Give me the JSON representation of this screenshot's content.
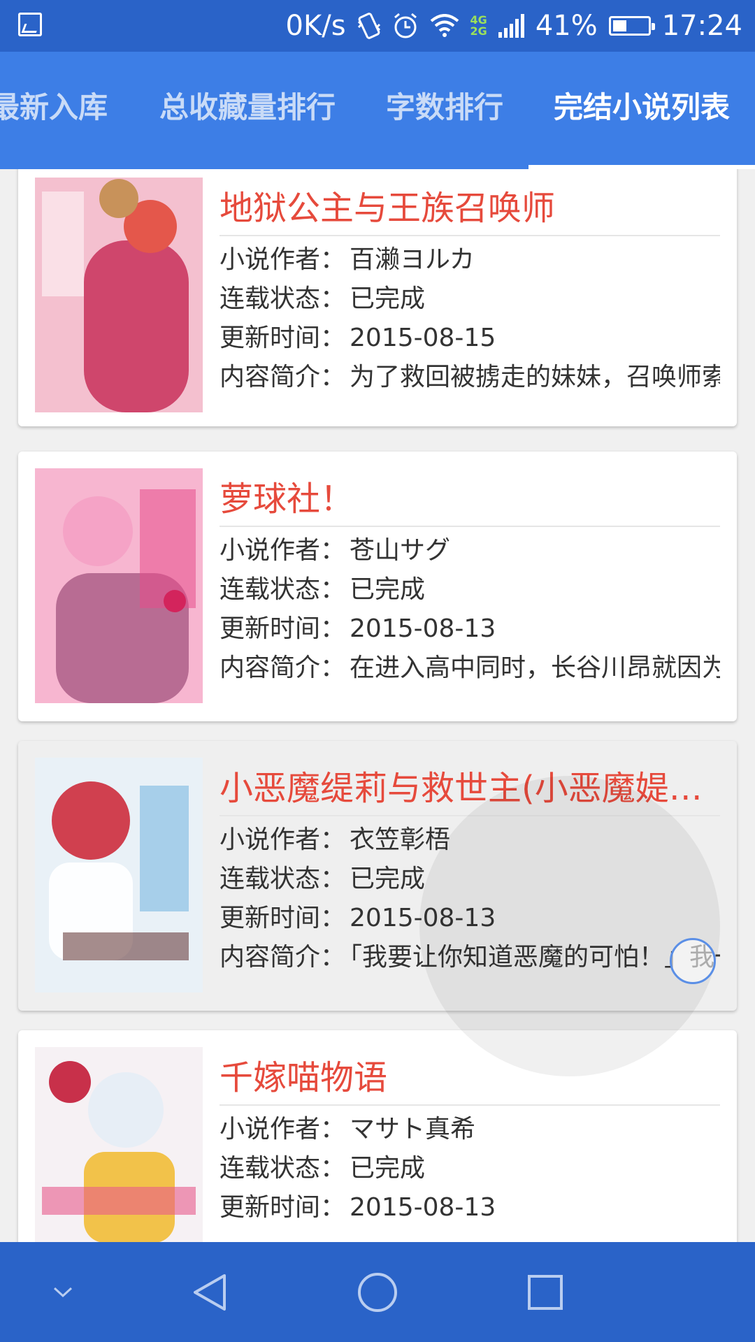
{
  "status_bar": {
    "speed": "0K/s",
    "network_top": "4G",
    "network_bottom": "2G",
    "battery": "41%",
    "battery_level": 0.41,
    "time": "17:24"
  },
  "tabs": [
    {
      "label": "最新入库",
      "active": false
    },
    {
      "label": "总收藏量排行",
      "active": false
    },
    {
      "label": "字数排行",
      "active": false
    },
    {
      "label": "完结小说列表",
      "active": true
    }
  ],
  "labels": {
    "author": "小说作者：",
    "status": "连载状态：",
    "updated": "更新时间：",
    "summary": "内容简介："
  },
  "novels": [
    {
      "title": "地狱公主与王族召唤师",
      "author": "百濑ヨルカ",
      "status": "已完成",
      "updated": "2015-08-15",
      "summary": "为了救回被掳走的妹妹，召唤师索",
      "cover_colors": [
        "#f4c0cf",
        "#c8305a"
      ]
    },
    {
      "title": "萝球社！",
      "author": "苍山サグ",
      "status": "已完成",
      "updated": "2015-08-13",
      "summary": "在进入高中同时，长谷川昂就因为",
      "cover_colors": [
        "#f7b6d0",
        "#8e3a6a"
      ]
    },
    {
      "title": "小恶魔缇莉与救世主(小恶魔媞…",
      "author": "衣笠彰梧",
      "status": "已完成",
      "updated": "2015-08-13",
      "summary": "「我要让你知道恶魔的可怕！」我一",
      "cover_colors": [
        "#e9f1f7",
        "#c23a4a"
      ]
    },
    {
      "title": "千嫁喵物语",
      "author": "マサト真希",
      "status": "已完成",
      "updated": "2015-08-13",
      "summary": "",
      "cover_colors": [
        "#f6f1f4",
        "#f2c24a"
      ]
    }
  ]
}
